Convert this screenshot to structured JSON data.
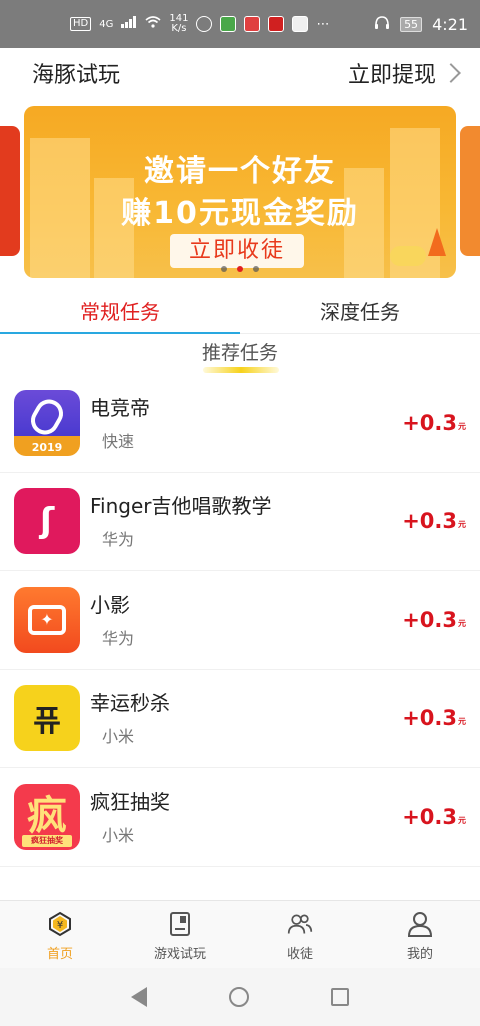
{
  "status_bar": {
    "hd": "HD",
    "network": "4G",
    "speed_value": "141",
    "speed_unit": "K/s",
    "battery": "55",
    "time": "4:21"
  },
  "header": {
    "title": "海豚试玩",
    "withdraw_label": "立即提现"
  },
  "banner": {
    "line1": "邀请一个好友",
    "line2": "赚10元现金奖励",
    "button_label": "立即收徒",
    "active_index": 1,
    "count": 3
  },
  "tabs": [
    {
      "label": "常规任务",
      "active": true
    },
    {
      "label": "深度任务",
      "active": false
    }
  ],
  "section": {
    "title": "推荐任务"
  },
  "tasks": [
    {
      "name": "电竞帝",
      "source": "快速",
      "reward": "+0.3",
      "unit": "元",
      "icon": "dianjingdi-app-icon",
      "icon_text": "2019"
    },
    {
      "name": "Finger吉他唱歌教学",
      "source": "华为",
      "reward": "+0.3",
      "unit": "元",
      "icon": "finger-app-icon",
      "icon_text": "ʃ"
    },
    {
      "name": "小影",
      "source": "华为",
      "reward": "+0.3",
      "unit": "元",
      "icon": "xiaoying-app-icon",
      "icon_text": "✦"
    },
    {
      "name": "幸运秒杀",
      "source": "小米",
      "reward": "+0.3",
      "unit": "元",
      "icon": "xingyun-app-icon",
      "icon_text": "퓨"
    },
    {
      "name": "疯狂抽奖",
      "source": "小米",
      "reward": "+0.3",
      "unit": "元",
      "icon": "fengkuang-app-icon",
      "icon_text": "疯",
      "icon_sub": "疯狂抽奖"
    }
  ],
  "bottom_nav": [
    {
      "label": "首页",
      "icon": "home-icon",
      "active": true
    },
    {
      "label": "游戏试玩",
      "icon": "game-icon",
      "active": false
    },
    {
      "label": "收徒",
      "icon": "friends-icon",
      "active": false
    },
    {
      "label": "我的",
      "icon": "profile-icon",
      "active": false
    }
  ],
  "colors": {
    "accent": "#e02020",
    "reward": "#d8141e",
    "nav_active": "#f0a020",
    "tab_indicator": "#29a8e0",
    "banner": "#f6a923"
  }
}
